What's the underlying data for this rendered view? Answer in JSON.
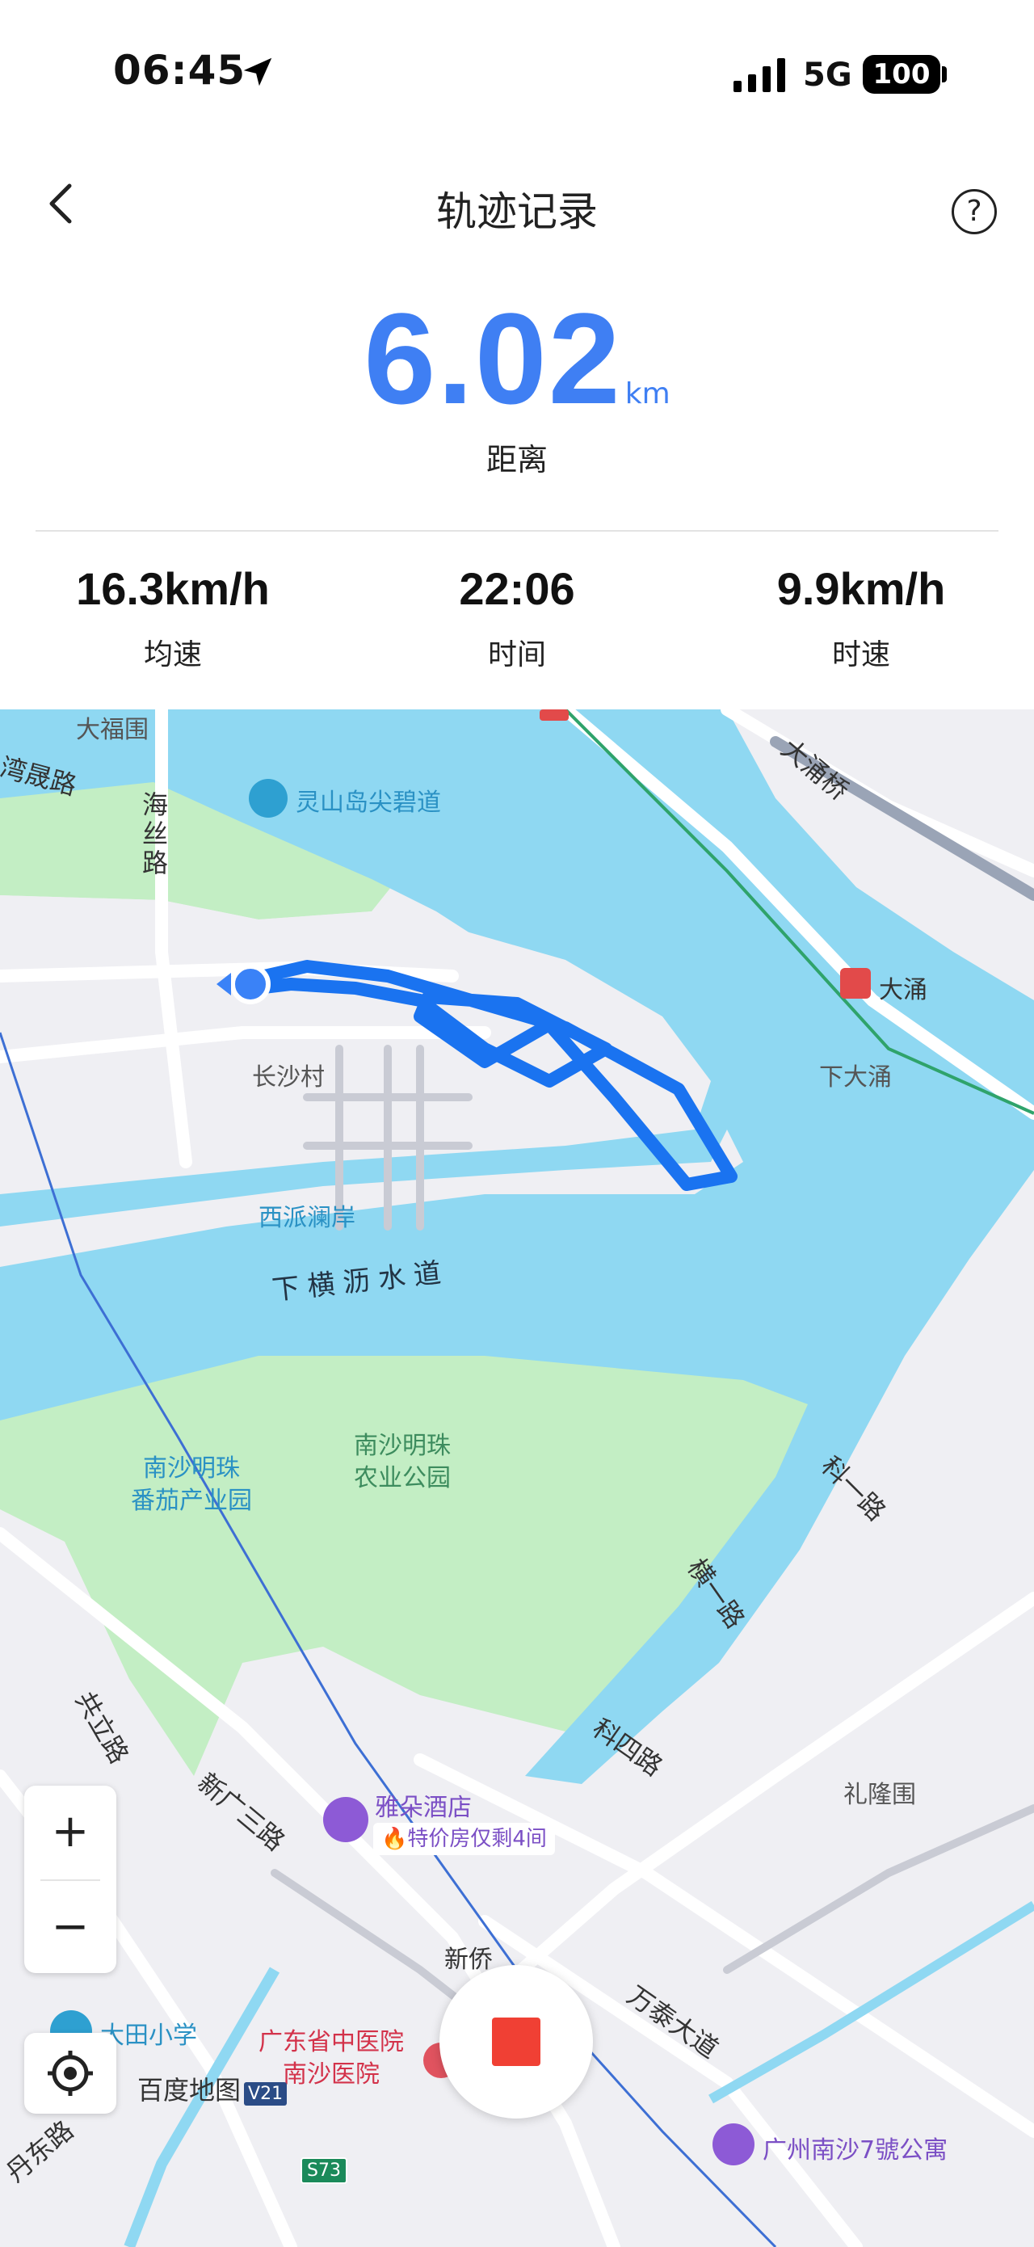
{
  "status_bar": {
    "time": "06:45",
    "network": "5G",
    "battery": "100"
  },
  "header": {
    "title": "轨迹记录",
    "help": "?"
  },
  "distance": {
    "value": "6.02",
    "unit": "km",
    "label": "距离"
  },
  "stats": [
    {
      "value": "16.3km/h",
      "label": "均速"
    },
    {
      "value": "22:06",
      "label": "时间"
    },
    {
      "value": "9.9km/h",
      "label": "时速"
    }
  ],
  "map": {
    "labels": {
      "dafuwei": "大福围",
      "wanshenglu": "湾晟路",
      "haisi": "海\n丝\n路",
      "lingshan": "灵山岛尖碧道",
      "dayongqiao": "大涌桥",
      "dayong": "大涌",
      "xiadayong": "下大涌",
      "changshacun": "长沙村",
      "xipai": "西派澜岸",
      "xiaheng": "下横沥水道",
      "fanqie": "南沙明珠\n番茄产业园",
      "nongye": "南沙明珠\n农业公园",
      "keyi": "科一路",
      "heng1": "横一路",
      "lilongwei": "礼隆围",
      "kesi": "科四路",
      "gongli": "共立路",
      "xinguang": "新广三路",
      "yaduo": "雅朵酒店",
      "deal": "🔥特价房仅剩4间",
      "xinqiao": "新侨",
      "wantai": "万泰大道",
      "datian": "大田小学",
      "hospital": "广东省中医院\n南沙医院",
      "baidu": "百度地图",
      "version": "V21",
      "s73": "S73",
      "apartment": "广州南沙7號公寓",
      "dandong": "丹东路"
    },
    "zoom_in": "+",
    "zoom_out": "−",
    "colors": {
      "water": "#8fd8f2",
      "park": "#c3eec4",
      "track": "#1a73f0",
      "land": "#efeff3"
    }
  }
}
